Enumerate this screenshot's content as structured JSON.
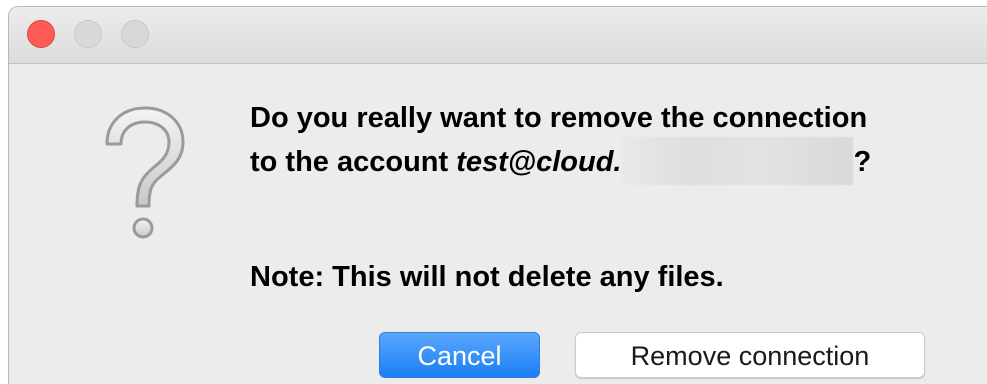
{
  "window": {
    "controls": [
      "close",
      "minimize",
      "maximize"
    ],
    "colors": {
      "close": "#fc5b57",
      "inactive": "#d8d8d8",
      "background": "#ececec"
    }
  },
  "dialog": {
    "icon": "question-mark-icon",
    "message_line1": "Do you really want to remove the connection",
    "message_line2_prefix": "to the account ",
    "account": "test@cloud.",
    "message_line2_suffix": "?",
    "note": "Note: This will not delete any files."
  },
  "buttons": {
    "cancel_label": "Cancel",
    "remove_label": "Remove connection",
    "accent_color": "#1a7ef6"
  }
}
